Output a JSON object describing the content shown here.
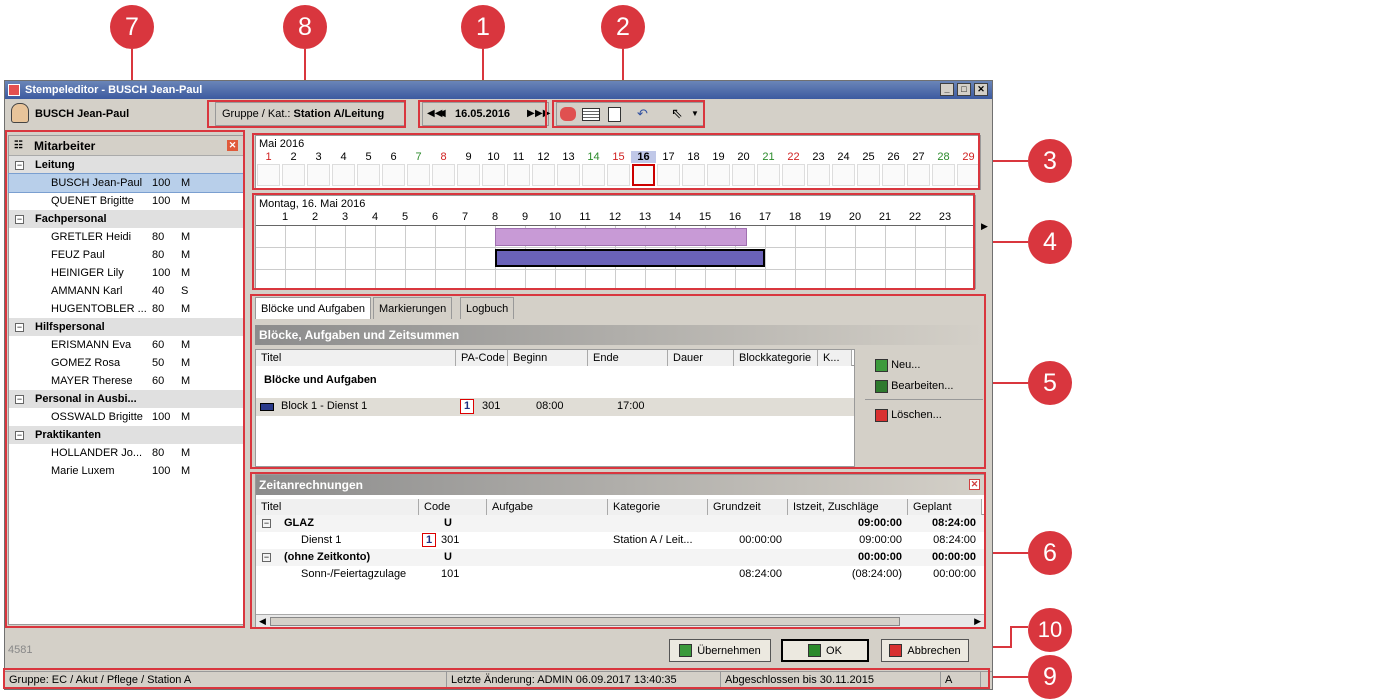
{
  "window": {
    "title": "Stempeleditor - BUSCH Jean-Paul",
    "user": "BUSCH Jean-Paul"
  },
  "group_box": {
    "label": "Gruppe / Kat.:",
    "value": "Station A/Leitung"
  },
  "date_nav": {
    "date": "16.05.2016"
  },
  "callouts": [
    "1",
    "2",
    "3",
    "4",
    "5",
    "6",
    "7",
    "8",
    "9",
    "10"
  ],
  "employees": {
    "title": "Mitarbeiter",
    "groups": [
      {
        "name": "Leitung",
        "members": [
          [
            "BUSCH Jean-Paul",
            "100",
            "M"
          ],
          [
            "QUENET Brigitte",
            "100",
            "M"
          ]
        ]
      },
      {
        "name": "Fachpersonal",
        "members": [
          [
            "GRETLER Heidi",
            "80",
            "M"
          ],
          [
            "FEUZ Paul",
            "80",
            "M"
          ],
          [
            "HEINIGER Lily",
            "100",
            "M"
          ],
          [
            "AMMANN Karl",
            "40",
            "S"
          ],
          [
            "HUGENTOBLER ...",
            "80",
            "M"
          ]
        ]
      },
      {
        "name": "Hilfspersonal",
        "members": [
          [
            "ERISMANN Eva",
            "60",
            "M"
          ],
          [
            "GOMEZ Rosa",
            "50",
            "M"
          ],
          [
            "MAYER Therese",
            "60",
            "M"
          ]
        ]
      },
      {
        "name": "Personal in Ausbi...",
        "members": [
          [
            "OSSWALD Brigitte",
            "100",
            "M"
          ]
        ]
      },
      {
        "name": "Praktikanten",
        "members": [
          [
            "HOLLANDER Jo...",
            "80",
            "M"
          ],
          [
            "Marie Luxem",
            "100",
            "M"
          ]
        ]
      }
    ]
  },
  "calendar": {
    "month": "Mai 2016",
    "days": [
      "1",
      "2",
      "3",
      "4",
      "5",
      "6",
      "7",
      "8",
      "9",
      "10",
      "11",
      "12",
      "13",
      "14",
      "15",
      "16",
      "17",
      "18",
      "19",
      "20",
      "21",
      "22",
      "23",
      "24",
      "25",
      "26",
      "27",
      "28",
      "29"
    ]
  },
  "day_view": {
    "title": "Montag, 16. Mai 2016",
    "hours": [
      "1",
      "2",
      "3",
      "4",
      "5",
      "6",
      "7",
      "8",
      "9",
      "10",
      "11",
      "12",
      "13",
      "14",
      "15",
      "16",
      "17",
      "18",
      "19",
      "20",
      "21",
      "22",
      "23"
    ]
  },
  "tabs": [
    "Blöcke und Aufgaben",
    "Markierungen",
    "Logbuch"
  ],
  "blocks": {
    "title": "Blöcke, Aufgaben und Zeitsummen",
    "columns": [
      "Titel",
      "PA-Code",
      "Beginn",
      "Ende",
      "Dauer",
      "Blockkategorie",
      "K..."
    ],
    "group": "Blöcke und Aufgaben",
    "row": {
      "title": "Block 1 - Dienst 1",
      "code": "301",
      "begin": "08:00",
      "end": "17:00",
      "badge": "1"
    },
    "actions": {
      "new": "Neu...",
      "edit": "Bearbeiten...",
      "delete": "Löschen..."
    }
  },
  "time_calc": {
    "title": "Zeitanrechnungen",
    "columns": [
      "Titel",
      "Code",
      "Aufgabe",
      "Kategorie",
      "Grundzeit",
      "Istzeit, Zuschläge",
      "Geplant"
    ],
    "rows": [
      {
        "title": "GLAZ",
        "code": "U",
        "aufgabe": "",
        "kategorie": "",
        "grundzeit": "",
        "istzeit": "09:00:00",
        "geplant": "08:24:00",
        "group": true
      },
      {
        "title": "Dienst 1",
        "code": "301",
        "aufgabe": "",
        "kategorie": "Station A / Leit...",
        "grundzeit": "00:00:00",
        "istzeit": "09:00:00",
        "geplant": "08:24:00",
        "group": false,
        "badge": "1"
      },
      {
        "title": "(ohne Zeitkonto)",
        "code": "U",
        "aufgabe": "",
        "kategorie": "",
        "grundzeit": "",
        "istzeit": "00:00:00",
        "geplant": "00:00:00",
        "group": true
      },
      {
        "title": "Sonn-/Feiertagzulage",
        "code": "101",
        "aufgabe": "",
        "kategorie": "",
        "grundzeit": "08:24:00",
        "istzeit": "(08:24:00)",
        "geplant": "00:00:00",
        "group": false
      }
    ]
  },
  "bottom": {
    "id": "4581",
    "apply": "Übernehmen",
    "ok": "OK",
    "cancel": "Abbrechen"
  },
  "status": {
    "group": "Gruppe: EC / Akut / Pflege / Station A",
    "last_change": "Letzte Änderung: ADMIN 06.09.2017 13:40:35",
    "closed": "Abgeschlossen bis 30.11.2015",
    "mode": "A"
  },
  "colors": {
    "accent": "#d9363e",
    "title": "#3c5aa0",
    "bar_plan": "#c89ad6",
    "bar_actual": "#6a62b8"
  }
}
